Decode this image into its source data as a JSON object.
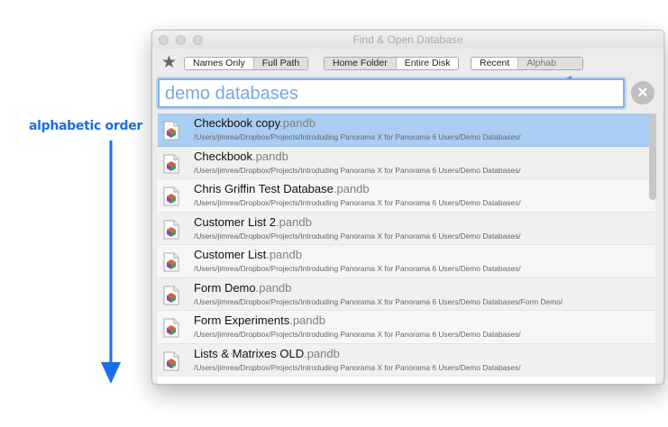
{
  "annotation": {
    "label": "alphabetic order"
  },
  "window": {
    "title": "Find & Open Database"
  },
  "toolbar": {
    "name_mode": [
      "Names Only",
      "Full Path"
    ],
    "scope": [
      "Home Folder",
      "Entire Disk"
    ],
    "order": [
      "Recent",
      "Alphab"
    ]
  },
  "search": {
    "value": "demo databases"
  },
  "results": [
    {
      "name": "Checkbook copy",
      "ext": ".pandb",
      "path": "/Users/jimrea/Dropbox/Projects/Introduding Panorama X for Panorama 6 Users/Demo Databases/"
    },
    {
      "name": "Checkbook",
      "ext": ".pandb",
      "path": "/Users/jimrea/Dropbox/Projects/Introduding Panorama X for Panorama 6 Users/Demo Databases/"
    },
    {
      "name": "Chris Griffin Test Database",
      "ext": ".pandb",
      "path": "/Users/jimrea/Dropbox/Projects/Introduding Panorama X for Panorama 6 Users/Demo Databases/"
    },
    {
      "name": "Customer List 2",
      "ext": ".pandb",
      "path": "/Users/jimrea/Dropbox/Projects/Introduding Panorama X for Panorama 6 Users/Demo Databases/"
    },
    {
      "name": "Customer List",
      "ext": ".pandb",
      "path": "/Users/jimrea/Dropbox/Projects/Introduding Panorama X for Panorama 6 Users/Demo Databases/"
    },
    {
      "name": "Form Demo",
      "ext": ".pandb",
      "path": "/Users/jimrea/Dropbox/Projects/Introduding Panorama X for Panorama 6 Users/Demo Databases/Form Demo/"
    },
    {
      "name": "Form Experiments",
      "ext": ".pandb",
      "path": "/Users/jimrea/Dropbox/Projects/Introduding Panorama X for Panorama 6 Users/Demo Databases/"
    },
    {
      "name": "Lists & Matrixes OLD",
      "ext": ".pandb",
      "path": "/Users/jimrea/Dropbox/Projects/Introduding Panorama X for Panorama 6 Users/Demo Databases/"
    }
  ]
}
